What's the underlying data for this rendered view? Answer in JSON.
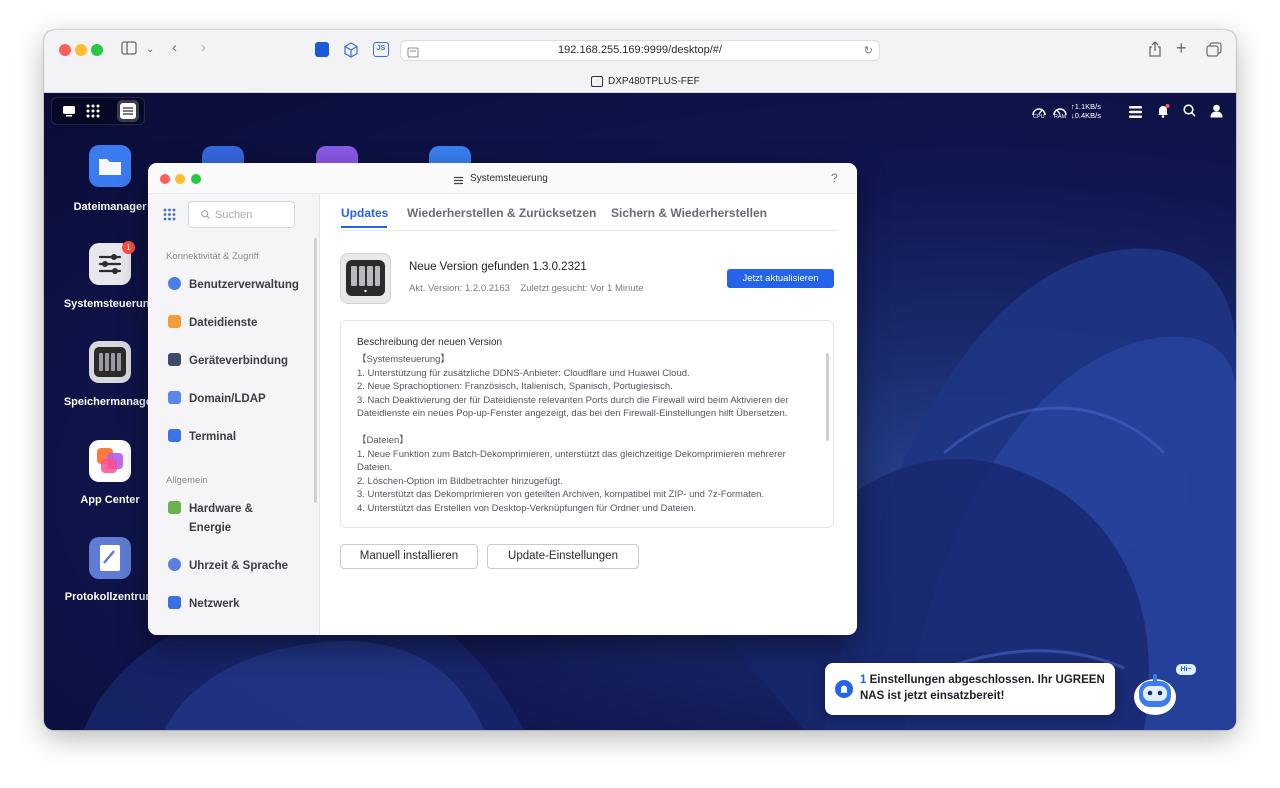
{
  "browser": {
    "url": "192.168.255.169:9999/desktop/#/",
    "tab_title": "DXP480TPLUS-FEF",
    "toolbar_icons": [
      "sidebar-icon",
      "chevron-down-icon",
      "back-icon",
      "forward-icon",
      "bitwarden-icon",
      "cube-icon",
      "js-icon",
      "share-icon",
      "plus-icon",
      "tabs-icon",
      "reload-icon",
      "page-icon"
    ]
  },
  "nas_topbar": {
    "cpu_label": "CPU",
    "ram_label": "RAM",
    "net_up": "↑1.1KB/s",
    "net_down": "↓0.4KB/s"
  },
  "desktop_apps": [
    {
      "label": "Dateimanager",
      "color": "#3b7bf0"
    },
    {
      "label": "Systemsteuerung",
      "color": "#e8e8ec",
      "badge": "1"
    },
    {
      "label": "Speichermanager",
      "color": "#2b2b2e"
    },
    {
      "label": "App Center",
      "color": "#ffffff"
    },
    {
      "label": "Protokollzentrum",
      "color": "#5f7bd3"
    }
  ],
  "window": {
    "title": "Systemsteuerung",
    "help": "?",
    "search_placeholder": "Suchen",
    "sections": [
      {
        "heading": "Konnektivität & Zugriff",
        "items": [
          "Benutzerverwaltung",
          "Dateidienste",
          "Geräteverbindung",
          "Domain/LDAP",
          "Terminal"
        ]
      },
      {
        "heading": "Allgemein",
        "items": [
          "Hardware &",
          "Energie",
          "Uhrzeit & Sprache",
          "Netzwerk"
        ]
      }
    ],
    "tabs": [
      "Updates",
      "Wiederherstellen & Zurücksetzen",
      "Sichern & Wiederherstellen"
    ],
    "active_tab": "Updates",
    "update": {
      "headline": "Neue Version gefunden 1.3.0.2321",
      "current_label": "Akt. Version",
      "current_value": "1.2.0.2163",
      "last_label": "Zuletzt gesucht",
      "last_value": "Vor 1 Minute",
      "update_button": "Jetzt aktualisieren"
    },
    "notes": {
      "title": "Beschreibung der neuen Version",
      "lines": [
        "【Systemsteuerung】",
        "1. Unterstützung für zusätzliche DDNS-Anbieter: Cloudflare und Huawei Cloud.",
        "2. Neue Sprachoptionen: Französisch, Italienisch, Spanisch, Portugiesisch.",
        "3. Nach Deaktivierung der für Dateidienste relevanten Ports durch die Firewall wird beim Aktivieren der",
        "Dateidienste ein neues Pop-up-Fenster angezeigt, das bei den Firewall-Einstellungen hilft Übersetzen.",
        "",
        "【Dateien】",
        "1. Neue Funktion zum Batch-Dekomprimieren, unterstützt das gleichzeitige Dekomprimieren mehrerer",
        "Dateien.",
        "2. Löschen-Option im Bildbetrachter hinzugefügt.",
        "3. Unterstützt das Dekomprimieren von geteilten Archiven, kompatibel mit ZIP- und 7z-Formaten.",
        "4. Unterstützt das Erstellen von Desktop-Verknüpfungen für Ordner und Dateien."
      ]
    },
    "buttons": {
      "manual": "Manuell installieren",
      "settings": "Update-Einstellungen"
    }
  },
  "toast": {
    "count": "1",
    "line1": " Einstellungen abgeschlossen. Ihr UGREEN",
    "line2": "NAS ist jetzt einsatzbereit!",
    "bubble": "Hi~"
  },
  "colors": {
    "accent": "#2563eb",
    "traffic_red": "#ff5f57",
    "traffic_yellow": "#febc2e",
    "traffic_green": "#28c840"
  }
}
